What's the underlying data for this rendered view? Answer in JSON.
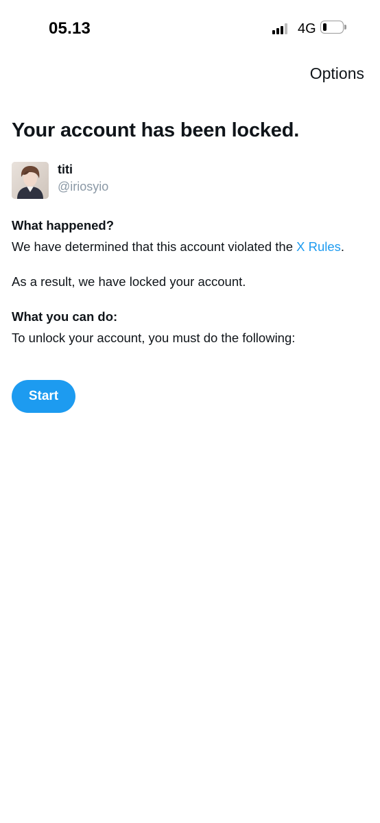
{
  "status_bar": {
    "time": "05.13",
    "network": "4G",
    "signal_bars": 4,
    "signal_bars_active": 3,
    "battery_level": 0.2
  },
  "header": {
    "options_label": "Options"
  },
  "main": {
    "title": "Your account has been locked.",
    "profile": {
      "name": "titi",
      "handle": "@iriosyio"
    },
    "what_happened": {
      "heading": "What happened?",
      "text_before_link": "We have determined that this account violated the ",
      "link_label": "X Rules",
      "text_after_link": "."
    },
    "result_text": "As a result, we have locked your account.",
    "what_you_can_do": {
      "heading": "What you can do:",
      "text": "To unlock your account, you must do the following:"
    },
    "start_button_label": "Start"
  },
  "colors": {
    "accent": "#1d9bf0",
    "text_primary": "#0f1419",
    "text_secondary": "#8a98a5",
    "background": "#ffffff"
  }
}
